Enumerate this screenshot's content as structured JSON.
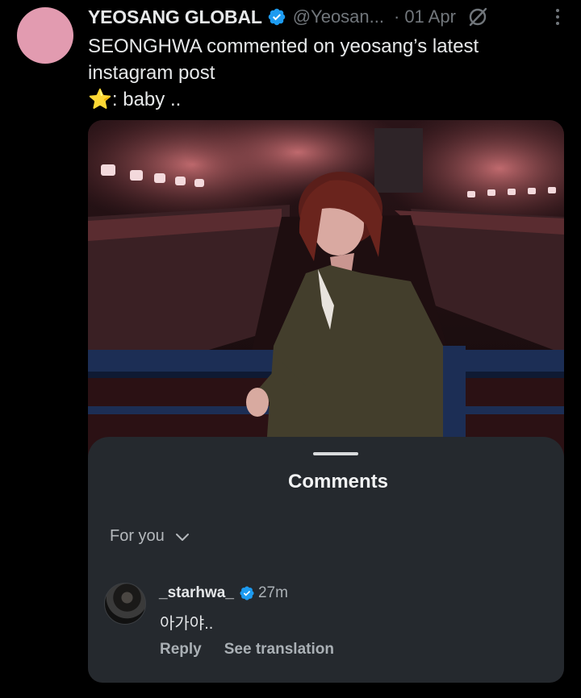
{
  "tweet": {
    "display_name": "YEOSANG GLOBAL",
    "handle": "@Yeosan...",
    "separator": "·",
    "date": "01 Apr",
    "text_line1": "SEONGHWA commented on yeosang’s latest",
    "text_line2": "instagram post",
    "star_emoji": "⭐",
    "text_line3": ": baby .."
  },
  "comments_sheet": {
    "title": "Comments",
    "filter_label": "For you",
    "comment": {
      "username": "_starhwa_",
      "time": "27m",
      "text": "아가야..",
      "reply_label": "Reply",
      "translate_label": "See translation"
    }
  },
  "colors": {
    "background": "#000000",
    "verified_blue": "#1d9bf0",
    "sheet_bg": "#25292e",
    "avatar_pink": "#e29bb0"
  },
  "icons": [
    "verified-badge-icon",
    "link-slash-icon",
    "more-vertical-icon",
    "chevron-down-icon"
  ]
}
